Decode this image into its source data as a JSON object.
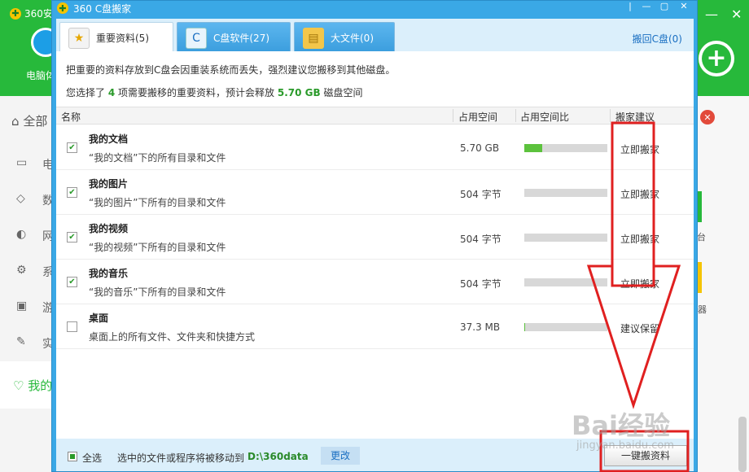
{
  "bg": {
    "title": "360安",
    "pc_label": "电脑体",
    "all_label": "全部",
    "left_items": [
      "电",
      "数",
      "网",
      "系",
      "游",
      "实"
    ],
    "selected_item": "我的",
    "right_labels": [
      "台",
      "器"
    ],
    "min_glyph": "—",
    "close_glyph": "✕"
  },
  "dialog": {
    "title": "360 C盘搬家",
    "controls": [
      "|",
      "—",
      "▢",
      "✕"
    ],
    "tabs": [
      {
        "label": "重要资料(5)",
        "active": true,
        "icon": "documents-star-icon"
      },
      {
        "label": "C盘软件(27)",
        "active": false,
        "icon": "c-drive-icon"
      },
      {
        "label": "大文件(0)",
        "active": false,
        "icon": "folder-icon"
      }
    ],
    "return_link": "搬回C盘(0)",
    "info_line1": "把重要的资料存放到C盘会因重装系统而丢失，强烈建议您搬移到其他磁盘。",
    "info_line2": {
      "prefix": "您选择了",
      "count": "4",
      "middle": "项需要搬移的重要资料，预计会释放",
      "size": "5.70 GB",
      "suffix": "磁盘空间"
    },
    "columns": [
      "名称",
      "占用空间",
      "占用空间比",
      "搬家建议"
    ],
    "rows": [
      {
        "title": "我的文档",
        "desc": "“我的文档”下的所有目录和文件",
        "size": "5.70 GB",
        "ratio": 0.22,
        "advice": "立即搬家",
        "checked": true
      },
      {
        "title": "我的图片",
        "desc": "“我的图片”下所有的目录和文件",
        "size": "504 字节",
        "ratio": 0,
        "advice": "立即搬家",
        "checked": true
      },
      {
        "title": "我的视频",
        "desc": "“我的视频”下所有的目录和文件",
        "size": "504 字节",
        "ratio": 0,
        "advice": "立即搬家",
        "checked": true
      },
      {
        "title": "我的音乐",
        "desc": "“我的音乐”下所有的目录和文件",
        "size": "504 字节",
        "ratio": 0,
        "advice": "立即搬家",
        "checked": true
      },
      {
        "title": "桌面",
        "desc": "桌面上的所有文件、文件夹和快捷方式",
        "size": "37.3 MB",
        "ratio": 0.01,
        "advice": "建议保留",
        "checked": false
      }
    ],
    "footer": {
      "select_all": "全选",
      "move_text": "选中的文件或程序将被移动到",
      "path": "D:\\360data",
      "change": "更改",
      "action": "一键搬资料"
    }
  },
  "watermark": {
    "main": "Bai经验",
    "sub": "jingyan.baidu.com"
  },
  "annotation_color": "#e02020"
}
